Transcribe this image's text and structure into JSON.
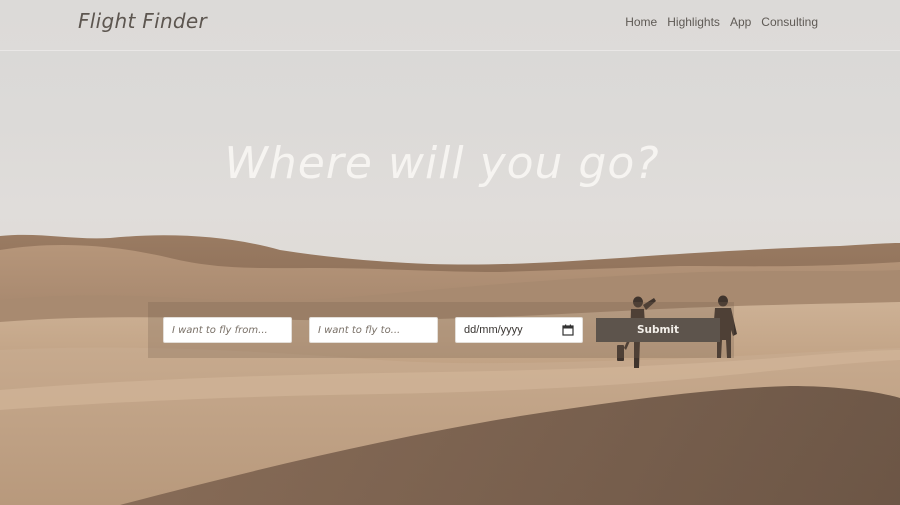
{
  "brand": "Flight Finder",
  "nav": {
    "items": [
      {
        "label": "Home"
      },
      {
        "label": "Highlights"
      },
      {
        "label": "App"
      },
      {
        "label": "Consulting"
      }
    ]
  },
  "hero": {
    "title": "Where will you go?"
  },
  "search": {
    "from_placeholder": "I want to fly from...",
    "to_placeholder": "I want to fly to...",
    "date_placeholder": "dd/mm/yyyy",
    "submit_label": "Submit"
  },
  "icons": {
    "date": "calendar-icon"
  },
  "colors": {
    "accent": "#5d544c",
    "sand": "#b08f73",
    "sky": "#dcdad8"
  }
}
